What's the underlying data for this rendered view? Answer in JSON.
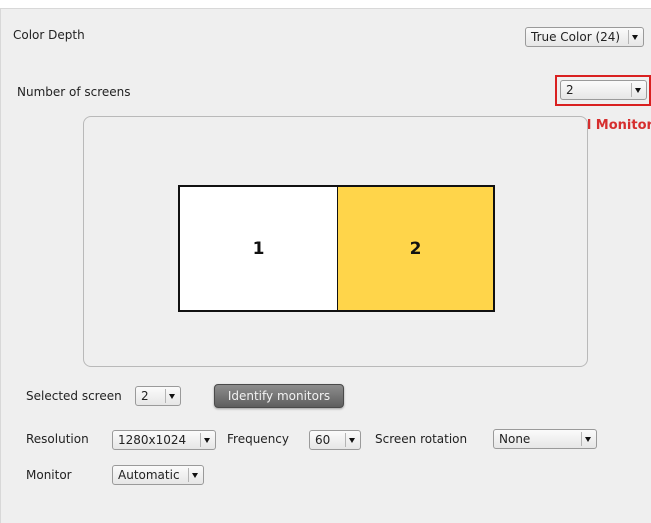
{
  "color_depth": {
    "label": "Color Depth",
    "value": "True Color (24)"
  },
  "num_screens": {
    "label": "Number of screens",
    "value": "2",
    "annotation": "Dual Monitor",
    "annotation_color": "#d62e2e"
  },
  "preview": {
    "screens": [
      {
        "label": "1",
        "color": "#ffffff"
      },
      {
        "label": "2",
        "color": "#ffd54a"
      }
    ]
  },
  "selected_screen": {
    "label": "Selected screen",
    "value": "2"
  },
  "identify_button": "Identify monitors",
  "resolution": {
    "label": "Resolution",
    "value": "1280x1024"
  },
  "frequency": {
    "label": "Frequency",
    "value": "60"
  },
  "rotation": {
    "label": "Screen rotation",
    "value": "None"
  },
  "monitor": {
    "label": "Monitor",
    "value": "Automatic"
  }
}
